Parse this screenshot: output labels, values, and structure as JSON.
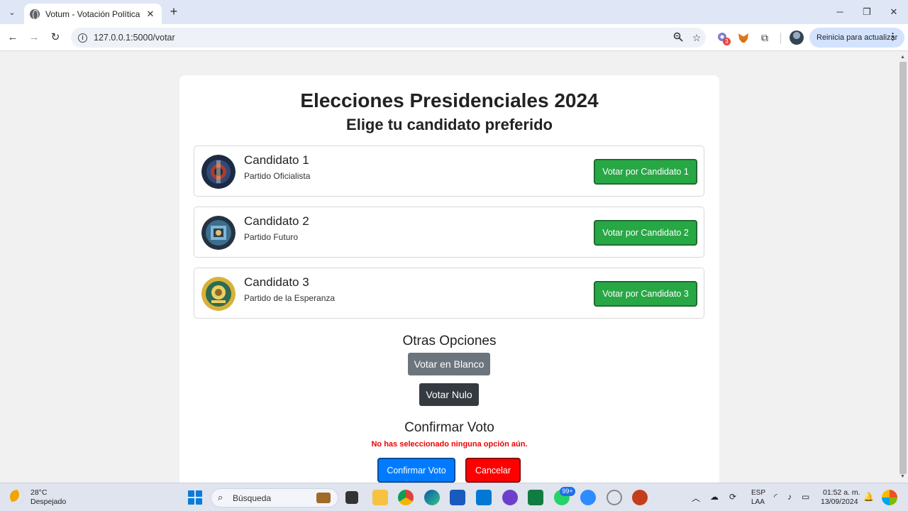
{
  "browser": {
    "tab_title": "Votum - Votación Política",
    "url": "127.0.0.1:5000/votar",
    "update_label": "Reinicia para actualizar",
    "extension_badge": "3",
    "window_controls": [
      "─",
      "❐",
      "✕"
    ]
  },
  "page": {
    "title": "Elecciones Presidenciales 2024",
    "subtitle": "Elige tu candidato preferido",
    "candidates": [
      {
        "name": "Candidato 1",
        "party": "Partido Oficialista",
        "button": "Votar por Candidato 1"
      },
      {
        "name": "Candidato 2",
        "party": "Partido Futuro",
        "button": "Votar por Candidato 2"
      },
      {
        "name": "Candidato 3",
        "party": "Partido de la Esperanza",
        "button": "Votar por Candidato 3"
      }
    ],
    "other_options_title": "Otras Opciones",
    "blank_vote_label": "Votar en Blanco",
    "null_vote_label": "Votar Nulo",
    "confirm_title": "Confirmar Voto",
    "warning": "No has seleccionado ninguna opción aún.",
    "confirm_label": "Confirmar Voto",
    "cancel_label": "Cancelar"
  },
  "colors": {
    "vote_green": "#28a745",
    "blank_gray": "#6c757d",
    "null_dark": "#343a40",
    "confirm_blue": "#007bff",
    "cancel_red": "#ff0000",
    "warning_red": "#e00000"
  },
  "taskbar": {
    "temperature": "28°C",
    "weather": "Despejado",
    "search_placeholder": "Búsqueda",
    "notification_badge": "99+",
    "language": "ESP",
    "layout": "LAA",
    "time": "01:52 a. m.",
    "date": "13/09/2024"
  }
}
